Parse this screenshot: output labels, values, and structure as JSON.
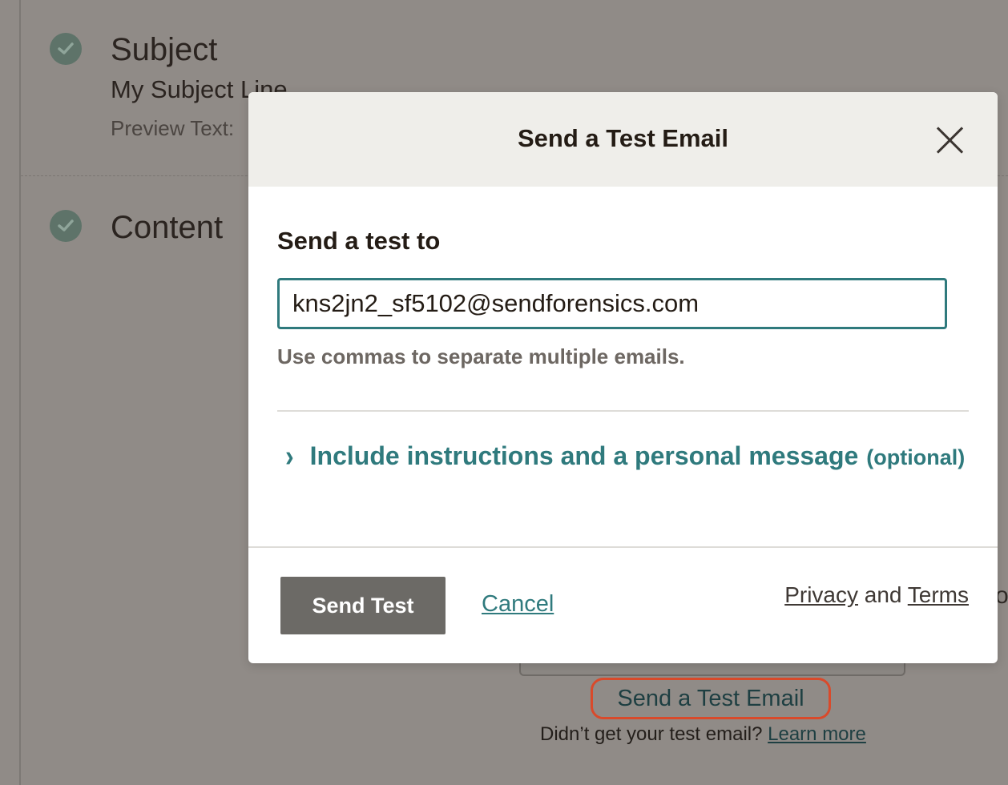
{
  "background": {
    "sections": [
      {
        "title": "Subject",
        "line": "My Subject Line",
        "preview_label": "Preview Text:"
      },
      {
        "title": "Content"
      }
    ],
    "send_test_link": "Send a Test Email",
    "help_text": "Didn’t get your test email?",
    "learn_more": "Learn more",
    "edge_glyph": "o"
  },
  "modal": {
    "title": "Send a Test Email",
    "field_label": "Send a test to",
    "email_value": "kns2jn2_sf5102@sendforensics.com",
    "helper": "Use commas to separate multiple emails.",
    "expand_label": "Include instructions and a personal message",
    "expand_optional": "(optional)",
    "chevron": "›",
    "send_button": "Send Test",
    "cancel": "Cancel",
    "privacy": "Privacy",
    "and": "and",
    "terms": "Terms"
  },
  "colors": {
    "accent": "#2f7a7d",
    "send_button_bg": "#6c6a66",
    "highlight_ring": "#d94a2b",
    "overlay": "#908b87"
  }
}
